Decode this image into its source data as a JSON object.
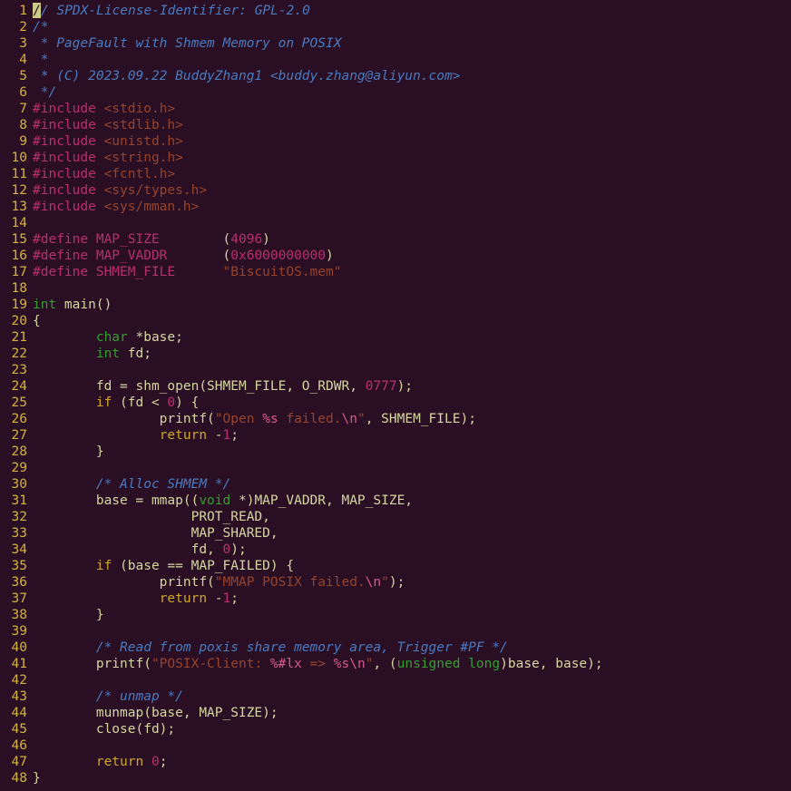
{
  "lines": [
    {
      "n": 1,
      "cursor": true,
      "tokens": [
        [
          "comment",
          "/ SPDX-License-Identifier: GPL-2.0"
        ]
      ]
    },
    {
      "n": 2,
      "tokens": [
        [
          "comment",
          "/*"
        ]
      ]
    },
    {
      "n": 3,
      "tokens": [
        [
          "comment",
          " * PageFault with Shmem Memory on POSIX"
        ]
      ]
    },
    {
      "n": 4,
      "tokens": [
        [
          "comment",
          " *"
        ]
      ]
    },
    {
      "n": 5,
      "tokens": [
        [
          "comment",
          " * (C) 2023.09.22 BuddyZhang1 <buddy.zhang@aliyun.com>"
        ]
      ]
    },
    {
      "n": 6,
      "tokens": [
        [
          "comment",
          " */"
        ]
      ]
    },
    {
      "n": 7,
      "tokens": [
        [
          "preproc",
          "#include "
        ],
        [
          "string",
          "<stdio.h>"
        ]
      ]
    },
    {
      "n": 8,
      "tokens": [
        [
          "preproc",
          "#include "
        ],
        [
          "string",
          "<stdlib.h>"
        ]
      ]
    },
    {
      "n": 9,
      "tokens": [
        [
          "preproc",
          "#include "
        ],
        [
          "string",
          "<unistd.h>"
        ]
      ]
    },
    {
      "n": 10,
      "tokens": [
        [
          "preproc",
          "#include "
        ],
        [
          "string",
          "<string.h>"
        ]
      ]
    },
    {
      "n": 11,
      "tokens": [
        [
          "preproc",
          "#include "
        ],
        [
          "string",
          "<fcntl.h>"
        ]
      ]
    },
    {
      "n": 12,
      "tokens": [
        [
          "preproc",
          "#include "
        ],
        [
          "string",
          "<sys/types.h>"
        ]
      ]
    },
    {
      "n": 13,
      "tokens": [
        [
          "preproc",
          "#include "
        ],
        [
          "string",
          "<sys/mman.h>"
        ]
      ]
    },
    {
      "n": 14,
      "tokens": []
    },
    {
      "n": 15,
      "tokens": [
        [
          "preproc",
          "#define MAP_SIZE        "
        ],
        [
          "plain",
          "("
        ],
        [
          "number",
          "4096"
        ],
        [
          "plain",
          ")"
        ]
      ]
    },
    {
      "n": 16,
      "tokens": [
        [
          "preproc",
          "#define MAP_VADDR       "
        ],
        [
          "plain",
          "("
        ],
        [
          "number",
          "0x6000000000"
        ],
        [
          "plain",
          ")"
        ]
      ]
    },
    {
      "n": 17,
      "tokens": [
        [
          "preproc",
          "#define SHMEM_FILE      "
        ],
        [
          "string",
          "\"BiscuitOS.mem\""
        ]
      ]
    },
    {
      "n": 18,
      "tokens": []
    },
    {
      "n": 19,
      "tokens": [
        [
          "type",
          "int"
        ],
        [
          "plain",
          " main()"
        ]
      ]
    },
    {
      "n": 20,
      "tokens": [
        [
          "plain",
          "{"
        ]
      ]
    },
    {
      "n": 21,
      "tokens": [
        [
          "plain",
          "        "
        ],
        [
          "type",
          "char"
        ],
        [
          "plain",
          " *base;"
        ]
      ]
    },
    {
      "n": 22,
      "tokens": [
        [
          "plain",
          "        "
        ],
        [
          "type",
          "int"
        ],
        [
          "plain",
          " fd;"
        ]
      ]
    },
    {
      "n": 23,
      "tokens": []
    },
    {
      "n": 24,
      "tokens": [
        [
          "plain",
          "        fd = shm_open(SHMEM_FILE, O_RDWR, "
        ],
        [
          "number",
          "0777"
        ],
        [
          "plain",
          ");"
        ]
      ]
    },
    {
      "n": 25,
      "tokens": [
        [
          "plain",
          "        "
        ],
        [
          "keyword",
          "if"
        ],
        [
          "plain",
          " (fd < "
        ],
        [
          "number",
          "0"
        ],
        [
          "plain",
          ") {"
        ]
      ]
    },
    {
      "n": 26,
      "tokens": [
        [
          "plain",
          "                printf("
        ],
        [
          "string",
          "\"Open "
        ],
        [
          "special",
          "%s"
        ],
        [
          "string",
          " failed."
        ],
        [
          "special",
          "\\n"
        ],
        [
          "string",
          "\""
        ],
        [
          "plain",
          ", SHMEM_FILE);"
        ]
      ]
    },
    {
      "n": 27,
      "tokens": [
        [
          "plain",
          "                "
        ],
        [
          "keyword",
          "return"
        ],
        [
          "plain",
          " -"
        ],
        [
          "number",
          "1"
        ],
        [
          "plain",
          ";"
        ]
      ]
    },
    {
      "n": 28,
      "tokens": [
        [
          "plain",
          "        }"
        ]
      ]
    },
    {
      "n": 29,
      "tokens": []
    },
    {
      "n": 30,
      "tokens": [
        [
          "plain",
          "        "
        ],
        [
          "comment",
          "/* Alloc SHMEM */"
        ]
      ]
    },
    {
      "n": 31,
      "tokens": [
        [
          "plain",
          "        base = mmap(("
        ],
        [
          "type",
          "void"
        ],
        [
          "plain",
          " *)MAP_VADDR, MAP_SIZE,"
        ]
      ]
    },
    {
      "n": 32,
      "tokens": [
        [
          "plain",
          "                    PROT_READ,"
        ]
      ]
    },
    {
      "n": 33,
      "tokens": [
        [
          "plain",
          "                    MAP_SHARED,"
        ]
      ]
    },
    {
      "n": 34,
      "tokens": [
        [
          "plain",
          "                    fd, "
        ],
        [
          "number",
          "0"
        ],
        [
          "plain",
          ");"
        ]
      ]
    },
    {
      "n": 35,
      "tokens": [
        [
          "plain",
          "        "
        ],
        [
          "keyword",
          "if"
        ],
        [
          "plain",
          " (base == MAP_FAILED) {"
        ]
      ]
    },
    {
      "n": 36,
      "tokens": [
        [
          "plain",
          "                printf("
        ],
        [
          "string",
          "\"MMAP POSIX failed."
        ],
        [
          "special",
          "\\n"
        ],
        [
          "string",
          "\""
        ],
        [
          "plain",
          ");"
        ]
      ]
    },
    {
      "n": 37,
      "tokens": [
        [
          "plain",
          "                "
        ],
        [
          "keyword",
          "return"
        ],
        [
          "plain",
          " -"
        ],
        [
          "number",
          "1"
        ],
        [
          "plain",
          ";"
        ]
      ]
    },
    {
      "n": 38,
      "tokens": [
        [
          "plain",
          "        }"
        ]
      ]
    },
    {
      "n": 39,
      "tokens": []
    },
    {
      "n": 40,
      "tokens": [
        [
          "plain",
          "        "
        ],
        [
          "comment",
          "/* Read from poxis share memory area, Trigger #PF */"
        ]
      ]
    },
    {
      "n": 41,
      "tokens": [
        [
          "plain",
          "        printf("
        ],
        [
          "string",
          "\"POSIX-Client: "
        ],
        [
          "special",
          "%#lx"
        ],
        [
          "string",
          " => "
        ],
        [
          "special",
          "%s"
        ],
        [
          "special",
          "\\n"
        ],
        [
          "string",
          "\""
        ],
        [
          "plain",
          ", ("
        ],
        [
          "type",
          "unsigned"
        ],
        [
          "plain",
          " "
        ],
        [
          "type",
          "long"
        ],
        [
          "plain",
          ")base, base);"
        ]
      ]
    },
    {
      "n": 42,
      "tokens": []
    },
    {
      "n": 43,
      "tokens": [
        [
          "plain",
          "        "
        ],
        [
          "comment",
          "/* unmap */"
        ]
      ]
    },
    {
      "n": 44,
      "tokens": [
        [
          "plain",
          "        munmap(base, MAP_SIZE);"
        ]
      ]
    },
    {
      "n": 45,
      "tokens": [
        [
          "plain",
          "        close(fd);"
        ]
      ]
    },
    {
      "n": 46,
      "tokens": []
    },
    {
      "n": 47,
      "tokens": [
        [
          "plain",
          "        "
        ],
        [
          "keyword",
          "return"
        ],
        [
          "plain",
          " "
        ],
        [
          "number",
          "0"
        ],
        [
          "plain",
          ";"
        ]
      ]
    },
    {
      "n": 48,
      "tokens": [
        [
          "plain",
          "}"
        ]
      ]
    }
  ],
  "token_classes": {
    "comment": "tk-comment",
    "preproc": "tk-preproc",
    "string": "tk-string",
    "number": "tk-number",
    "type": "tk-type",
    "keyword": "tk-keyword",
    "func": "tk-func",
    "special": "tk-special",
    "plain": "tk-plain"
  }
}
